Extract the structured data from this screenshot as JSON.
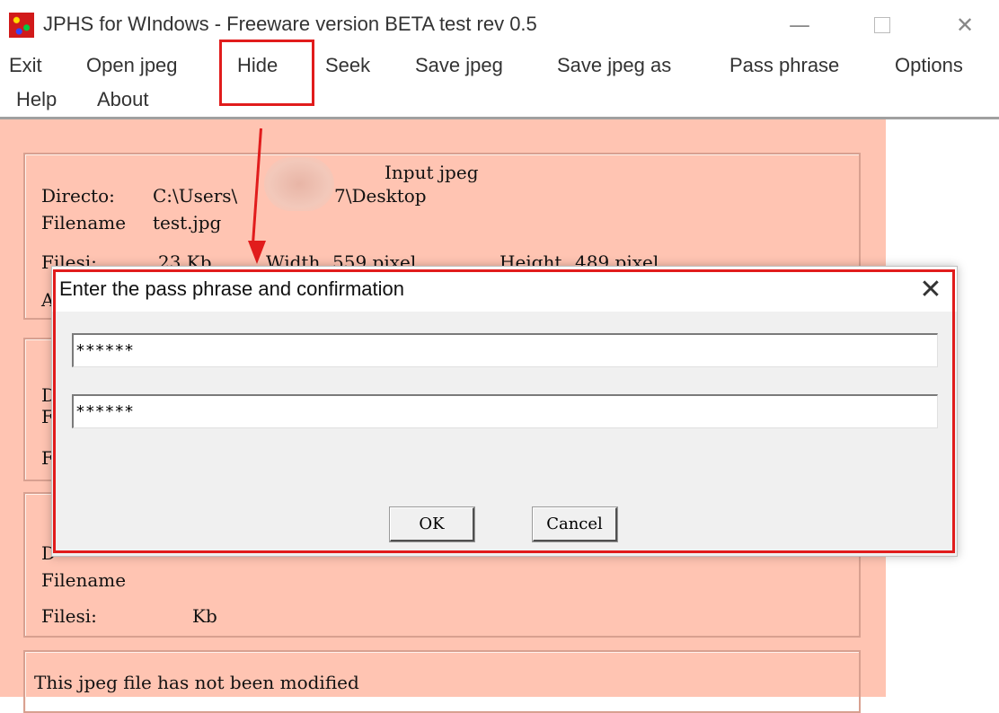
{
  "window": {
    "title": "JPHS for WIndows - Freeware version BETA test rev 0.5",
    "minimize_glyph": "—",
    "close_glyph": "✕",
    "icon": "jphs-app-icon"
  },
  "menu": {
    "items": [
      "Exit",
      "Open jpeg",
      "Hide",
      "Seek",
      "Save jpeg",
      "Save jpeg as",
      "Pass phrase",
      "Options",
      "Help",
      "About"
    ],
    "highlighted": "Hide",
    "highlight_color": "#e11c1c"
  },
  "input_jpeg": {
    "heading": "Input jpeg",
    "directory_label": "Directo:",
    "directory_value_start": "C:\\Users\\",
    "directory_value_end": "7\\Desktop",
    "filename_label": "Filename",
    "filename_value": "test.jpg",
    "filesize_label": "Filesi:",
    "filesize_value": "23 Kb",
    "width_label": "Width",
    "width_value": "559 pixel",
    "height_label": "Height",
    "height_value": "489 pixel",
    "partial_row_char": "A"
  },
  "group2": {
    "line1": "D",
    "line2": "F",
    "line3": "F"
  },
  "group3": {
    "directory_label": "D",
    "filename_label": "Filename",
    "filesize_label": "Filesi:",
    "filesize_unit": "Kb"
  },
  "status": {
    "text": "This jpeg file has not been modified"
  },
  "dialog": {
    "title": "Enter the pass phrase and confirmation",
    "close_glyph": "✕",
    "pass_phrase_value": "******",
    "confirmation_value": "******",
    "ok_label": "OK",
    "cancel_label": "Cancel"
  },
  "colors": {
    "panel_background": "#ffc4b2",
    "annotation_red": "#e11c1c",
    "dialog_background": "#f0f0f0"
  }
}
